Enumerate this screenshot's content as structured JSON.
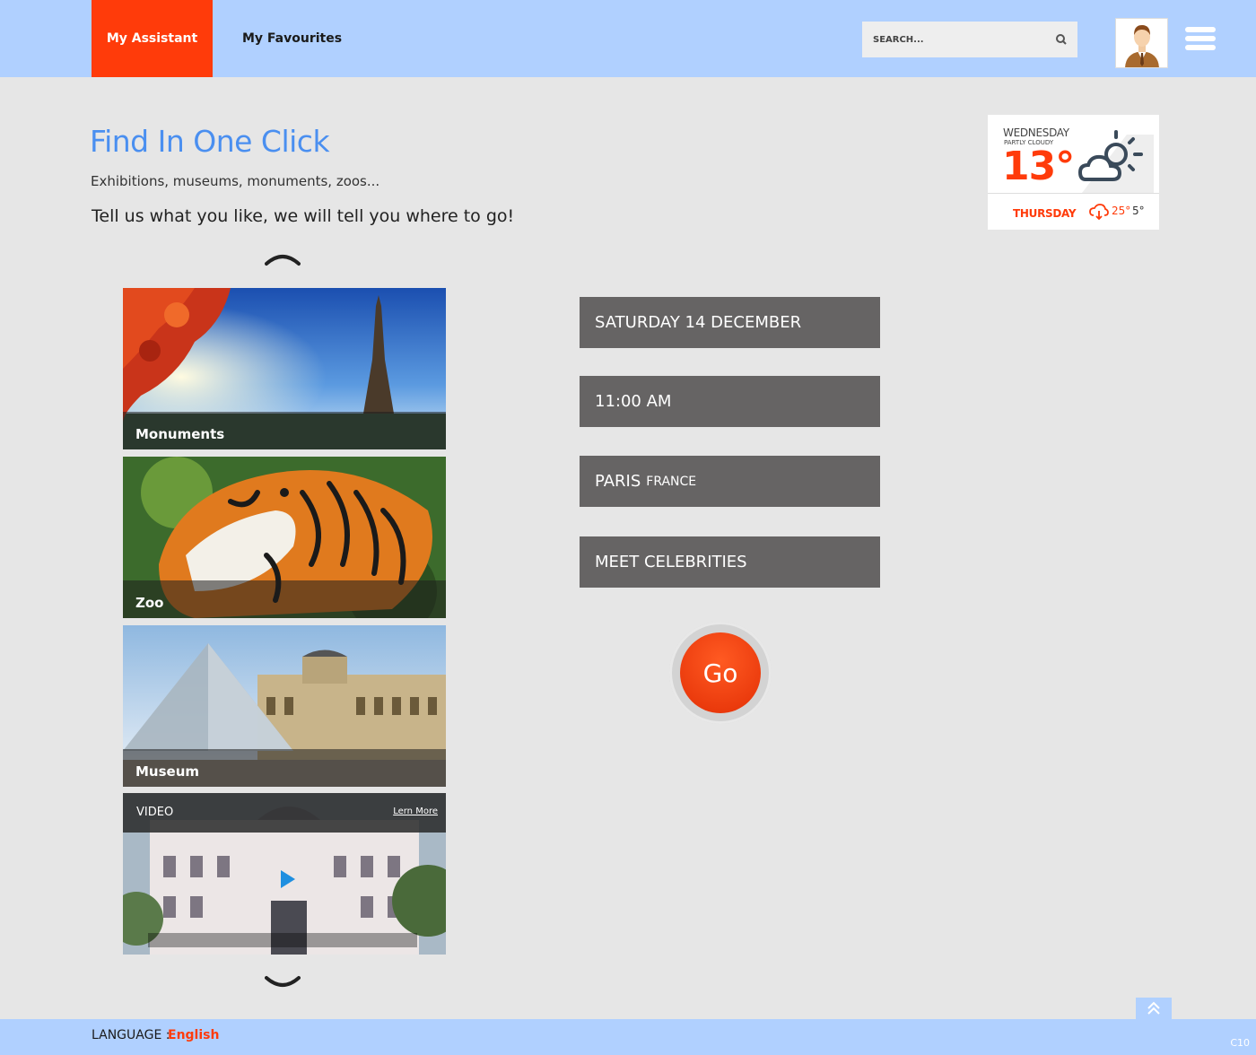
{
  "header": {
    "tabs": [
      {
        "label": "My Assistant",
        "active": true
      },
      {
        "label": "My Favourites",
        "active": false
      }
    ],
    "search": {
      "placeholder": "SEARCH..."
    },
    "accent_color": "#ff3b0a",
    "bar_color": "#b0d0ff"
  },
  "hero": {
    "title": "Find In One Click",
    "subtitle": "Exhibitions, museums, monuments, zoos...",
    "tagline": "Tell us what you like, we will tell you where to go!"
  },
  "weather": {
    "day": "WEDNESDAY",
    "condition": "PARTLY CLOUDY",
    "temperature": "13°",
    "next_day": "THURSDAY",
    "next_high": "25°",
    "next_low": "5°",
    "icon": "partly-cloudy-icon"
  },
  "carousel": {
    "cards": [
      {
        "label": "Monuments"
      },
      {
        "label": "Zoo"
      },
      {
        "label": "Museum"
      }
    ],
    "video": {
      "label": "VIDEO",
      "link": "Lern More"
    }
  },
  "form": {
    "date": "SATURDAY 14 DECEMBER",
    "time": "11:00 AM",
    "city": "PARIS",
    "country": "FRANCE",
    "activity": "MEET CELEBRITIES",
    "go_label": "Go"
  },
  "footer": {
    "language_label": "LANGUAGE :",
    "language_value": "English",
    "code": "C10"
  }
}
